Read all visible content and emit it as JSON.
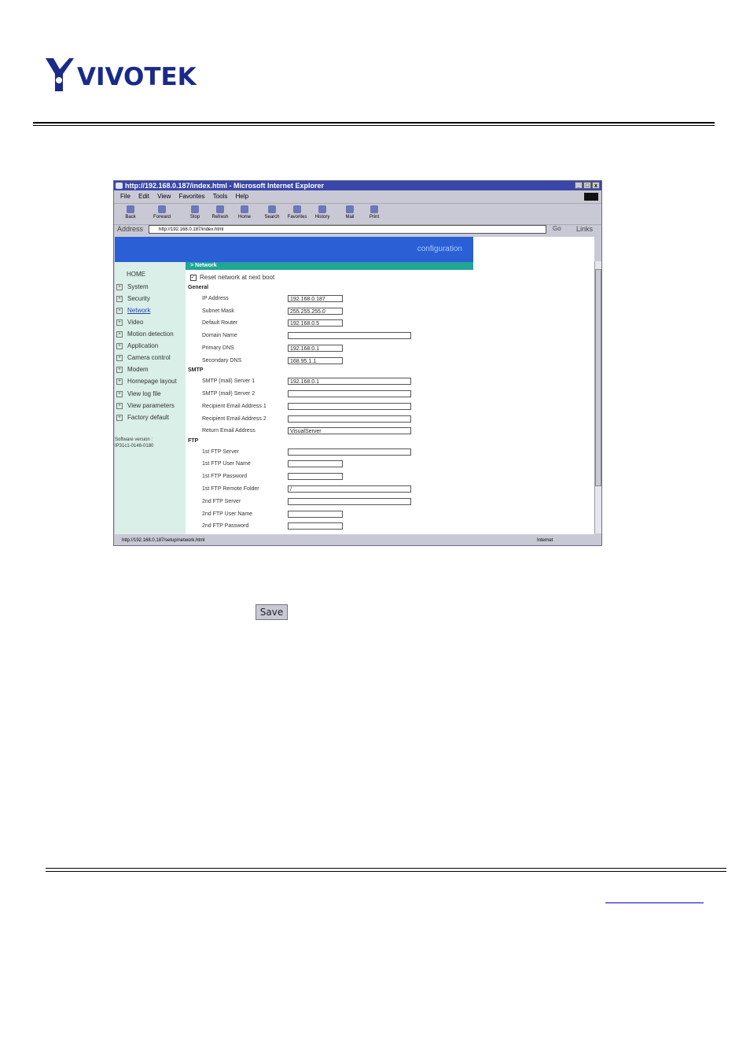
{
  "brand": {
    "logo_text": "VIVOTEK"
  },
  "browser": {
    "title": "http://192.168.0.187/index.html - Microsoft Internet Explorer",
    "window_buttons": [
      "_",
      "□",
      "x"
    ],
    "menu": [
      "File",
      "Edit",
      "View",
      "Favorites",
      "Tools",
      "Help"
    ],
    "toolbar": [
      "Back",
      "Forward",
      "Stop",
      "Refresh",
      "Home",
      "Search",
      "Favorites",
      "History",
      "Mail",
      "Print"
    ],
    "address_label": "Address",
    "address_value": "http://192.168.0.187/index.html",
    "go_label": "Go",
    "links_label": "Links",
    "status_url": "http://192.168.0.187/setup/network.html",
    "status_zone": "Internet"
  },
  "page": {
    "banner_text": "configuration",
    "nav": {
      "home": "HOME",
      "items": [
        "System",
        "Security",
        "Network",
        "Video",
        "Motion detection",
        "Application",
        "Camera control",
        "Modem",
        "Homepage layout",
        "View log file",
        "View parameters",
        "Factory default"
      ],
      "software_version": "Software version :",
      "software_version_value": "IP31c1-0148-0180"
    },
    "section_title": "> Network",
    "reset_label": "Reset network at next boot",
    "general": {
      "header": "General",
      "fields": [
        {
          "label": "IP Address",
          "value": "192.168.0.187"
        },
        {
          "label": "Subnet Mask",
          "value": "255.255.255.0"
        },
        {
          "label": "Default Router",
          "value": "192.168.0.5"
        },
        {
          "label": "Domain Name",
          "value": ""
        },
        {
          "label": "Primary DNS",
          "value": "192.168.0.1"
        },
        {
          "label": "Secondary DNS",
          "value": "168.95.1.1"
        }
      ]
    },
    "smtp": {
      "header": "SMTP",
      "fields": [
        {
          "label": "SMTP (mail) Server 1",
          "value": "192.168.0.1"
        },
        {
          "label": "SMTP (mail) Server 2",
          "value": ""
        },
        {
          "label": "Recipient Email Address 1",
          "value": ""
        },
        {
          "label": "Recipient Email Address 2",
          "value": ""
        },
        {
          "label": "Return Email Address",
          "value": "VisualServer"
        }
      ]
    },
    "ftp": {
      "header": "FTP",
      "fields": [
        {
          "label": "1st FTP Server",
          "value": ""
        },
        {
          "label": "1st FTP User Name",
          "value": ""
        },
        {
          "label": "1st FTP Password",
          "value": ""
        },
        {
          "label": "1st FTP Remote Folder",
          "value": "/"
        },
        {
          "label": "2nd FTP Server",
          "value": ""
        },
        {
          "label": "2nd FTP User Name",
          "value": ""
        },
        {
          "label": "2nd FTP Password",
          "value": ""
        }
      ]
    }
  },
  "save_button": "Save"
}
